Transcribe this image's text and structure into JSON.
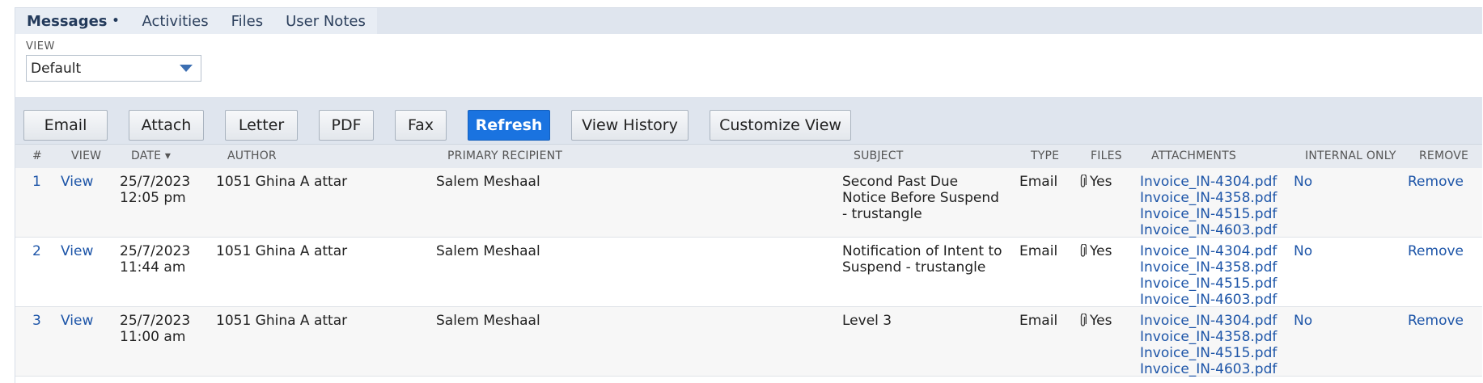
{
  "tabs": [
    {
      "label": "Messages",
      "active": true,
      "indicator": "•"
    },
    {
      "label": "Activities",
      "active": false
    },
    {
      "label": "Files",
      "active": false
    },
    {
      "label": "User Notes",
      "active": false
    }
  ],
  "view": {
    "label": "VIEW",
    "selected": "Default"
  },
  "toolbar": {
    "email": "Email",
    "attach": "Attach",
    "letter": "Letter",
    "pdf": "PDF",
    "fax": "Fax",
    "refresh": "Refresh",
    "view_history": "View History",
    "customize_view": "Customize View"
  },
  "columns": {
    "num": "#",
    "view": "VIEW",
    "date": "DATE ▾",
    "author": "AUTHOR",
    "primary_recipient": "PRIMARY RECIPIENT",
    "subject": "SUBJECT",
    "type": "TYPE",
    "files": "FILES",
    "attachments": "ATTACHMENTS",
    "internal_only": "INTERNAL ONLY",
    "remove": "REMOVE"
  },
  "rows": [
    {
      "num": "1",
      "view": "View",
      "date": "25/7/2023",
      "time": "12:05 pm",
      "author": "1051 Ghina A attar",
      "recipient": "Salem Meshaal",
      "subject": "Second Past Due Notice Before Suspend - trustangle",
      "type": "Email",
      "files": "Yes",
      "attachments": [
        "Invoice_IN-4304.pdf",
        "Invoice_IN-4358.pdf",
        "Invoice_IN-4515.pdf",
        "Invoice_IN-4603.pdf"
      ],
      "internal_only": "No",
      "remove": "Remove"
    },
    {
      "num": "2",
      "view": "View",
      "date": "25/7/2023",
      "time": "11:44 am",
      "author": "1051 Ghina A attar",
      "recipient": "Salem Meshaal",
      "subject": "Notification of Intent to Suspend - trustangle",
      "type": "Email",
      "files": "Yes",
      "attachments": [
        "Invoice_IN-4304.pdf",
        "Invoice_IN-4358.pdf",
        "Invoice_IN-4515.pdf",
        "Invoice_IN-4603.pdf"
      ],
      "internal_only": "No",
      "remove": "Remove"
    },
    {
      "num": "3",
      "view": "View",
      "date": "25/7/2023",
      "time": "11:00 am",
      "author": "1051 Ghina A attar",
      "recipient": "Salem Meshaal",
      "subject": "Level 3",
      "type": "Email",
      "files": "Yes",
      "attachments": [
        "Invoice_IN-4304.pdf",
        "Invoice_IN-4358.pdf",
        "Invoice_IN-4515.pdf",
        "Invoice_IN-4603.pdf"
      ],
      "internal_only": "No",
      "remove": "Remove"
    }
  ],
  "icons": {
    "attachment": "paperclip-icon",
    "dropdown": "chevron-down-icon"
  },
  "colors": {
    "link": "#1d55a8",
    "primary_button": "#1a73e0",
    "header_bg": "#dfe5ee"
  }
}
